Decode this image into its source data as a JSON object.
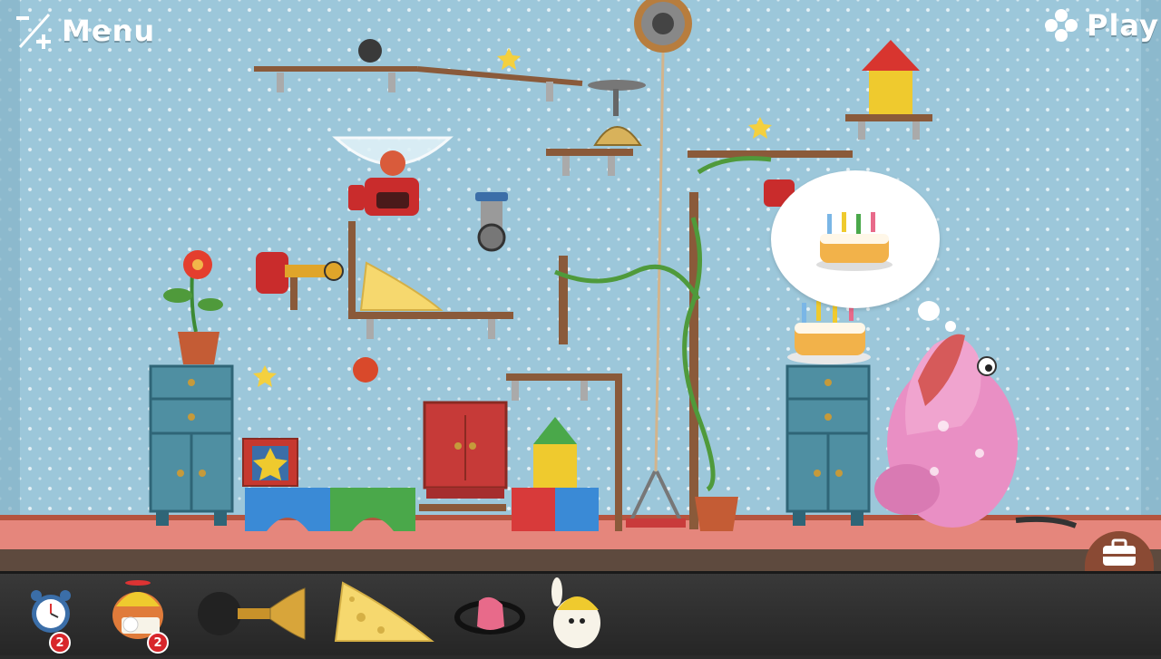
{
  "hud": {
    "menu_label": "Menu",
    "play_label": "Play",
    "menu_icon": "plus-minus-icon",
    "play_icon": "dots-cluster-icon"
  },
  "scene": {
    "goal_thought": "birthday-cake",
    "colors": {
      "wall": "#9cc7da",
      "floor": "#e5867c",
      "cabinet_blue": "#4f8fa2",
      "cabinet_red": "#c63a38",
      "monster_pink": "#e98fc4"
    }
  },
  "toolbar": {
    "items": [
      {
        "name": "alarm-clock",
        "count": "2"
      },
      {
        "name": "propeller-hat-critter",
        "count": "2"
      },
      {
        "name": "bike-horn",
        "count": ""
      },
      {
        "name": "cheese-wedge",
        "count": ""
      },
      {
        "name": "boxing-glove-spring",
        "count": ""
      },
      {
        "name": "bunny-helmet-critter",
        "count": ""
      }
    ],
    "toolbox_icon": "toolbox-icon"
  }
}
